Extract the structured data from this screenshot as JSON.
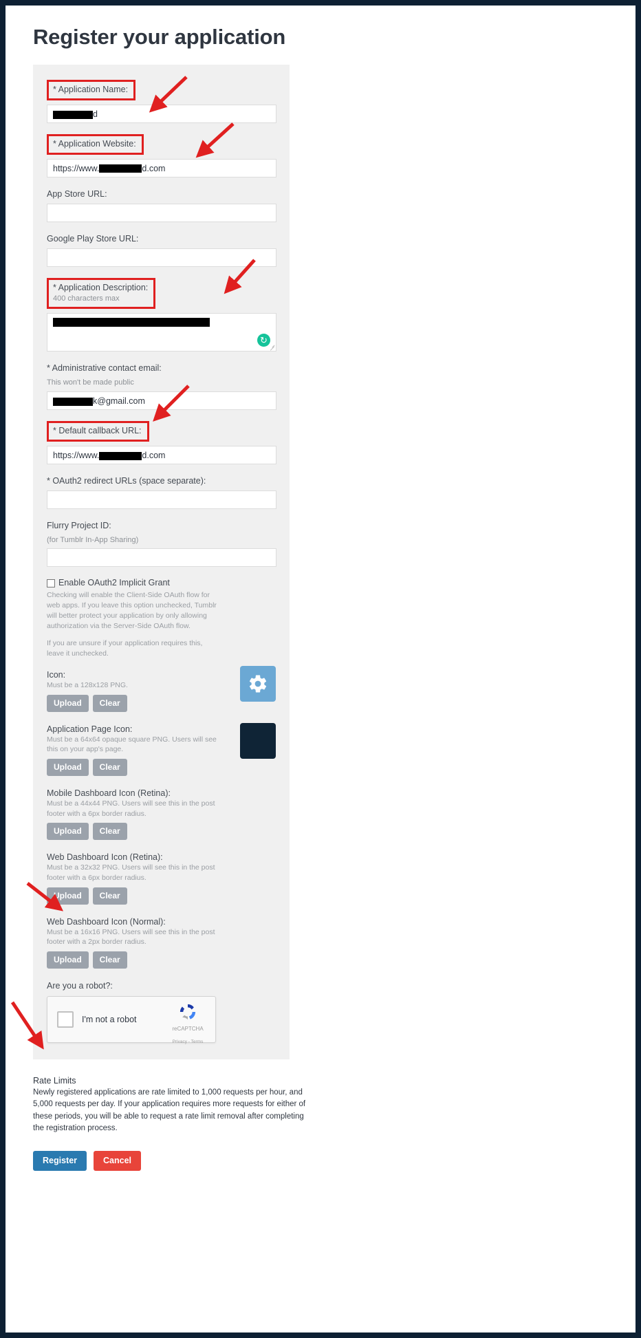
{
  "page": {
    "title": "Register your application"
  },
  "form": {
    "app_name": {
      "label": "* Application Name:",
      "value_suffix": "d",
      "highlighted": true
    },
    "app_website": {
      "label": "* Application Website:",
      "value_prefix": "https://www.",
      "value_suffix": "d.com",
      "highlighted": true
    },
    "app_store_url": {
      "label": "App Store URL:",
      "value": ""
    },
    "google_play_url": {
      "label": "Google Play Store URL:",
      "value": ""
    },
    "app_description": {
      "label": "* Application Description:",
      "sub": "400 characters max",
      "highlighted": true
    },
    "admin_email": {
      "label": "* Administrative contact email:",
      "sub": "This won't be made public",
      "value_suffix": "k@gmail.com"
    },
    "callback_url": {
      "label": "* Default callback URL:",
      "value_prefix": "https://www.",
      "value_suffix": "d.com",
      "highlighted": true
    },
    "oauth2_redirect": {
      "label": "* OAuth2 redirect URLs (space separate):",
      "value": ""
    },
    "flurry": {
      "label": "Flurry Project ID:",
      "sub": "(for Tumblr In-App Sharing)",
      "value": ""
    },
    "implicit_grant": {
      "label": "Enable OAuth2 Implicit Grant",
      "checked": false,
      "help1": "Checking will enable the Client-Side OAuth flow for web apps. If you leave this option unchecked, Tumblr will better protect your application by only allowing authorization via the Server-Side OAuth flow.",
      "help2": "If you are unsure if your application requires this, leave it unchecked."
    },
    "icons": [
      {
        "title": "Icon:",
        "desc": "Must be a 128x128 PNG.",
        "upload": "Upload",
        "clear": "Clear",
        "preview": "gear"
      },
      {
        "title": "Application Page Icon:",
        "desc": "Must be a 64x64 opaque square PNG. Users will see this on your app's page.",
        "upload": "Upload",
        "clear": "Clear",
        "preview": "dark"
      },
      {
        "title": "Mobile Dashboard Icon (Retina):",
        "desc": "Must be a 44x44 PNG. Users will see this in the post footer with a 6px border radius.",
        "upload": "Upload",
        "clear": "Clear",
        "preview": "none"
      },
      {
        "title": "Web Dashboard Icon (Retina):",
        "desc": "Must be a 32x32 PNG. Users will see this in the post footer with a 6px border radius.",
        "upload": "Upload",
        "clear": "Clear",
        "preview": "none"
      },
      {
        "title": "Web Dashboard Icon (Normal):",
        "desc": "Must be a 16x16 PNG. Users will see this in the post footer with a 2px border radius.",
        "upload": "Upload",
        "clear": "Clear",
        "preview": "none"
      }
    ],
    "captcha": {
      "label": "Are you a robot?:",
      "checkbox_label": "I'm not a robot",
      "brand": "reCAPTCHA",
      "links": "Privacy - Terms",
      "checked": false
    }
  },
  "rate_limits": {
    "title": "Rate Limits",
    "body": "Newly registered applications are rate limited to 1,000 requests per hour, and 5,000 requests per day. If your application requires more requests for either of these periods, you will be able to request a rate limit removal after completing the registration process."
  },
  "actions": {
    "register": "Register",
    "cancel": "Cancel"
  },
  "colors": {
    "accent_red": "#e02020",
    "register_blue": "#2a7ab0",
    "cancel_red": "#e8443a",
    "gray_button": "#9ba2ab",
    "panel_bg": "#f0f0f0"
  }
}
